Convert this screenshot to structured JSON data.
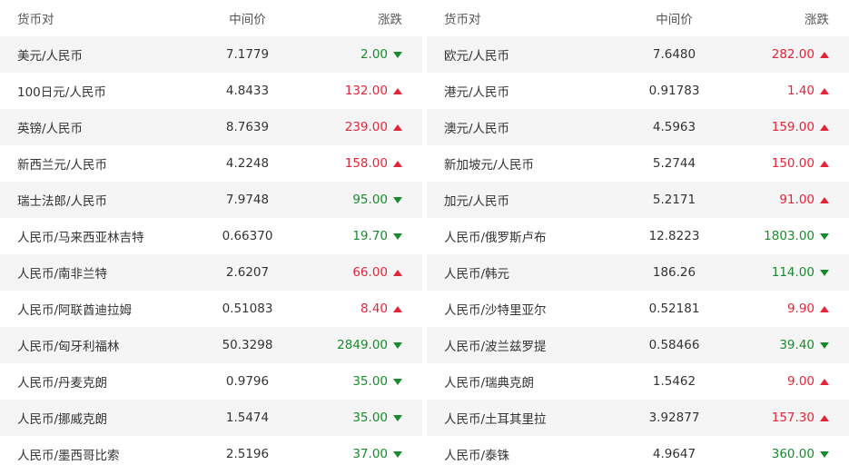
{
  "headers": {
    "pair": "货币对",
    "mid": "中间价",
    "change": "涨跌"
  },
  "colors": {
    "up": "#e5243a",
    "down": "#1a8a2e",
    "stripe": "#f5f5f5"
  },
  "left": [
    {
      "pair": "美元/人民币",
      "mid": "7.1779",
      "change": "2.00",
      "dir": "down"
    },
    {
      "pair": "100日元/人民币",
      "mid": "4.8433",
      "change": "132.00",
      "dir": "up"
    },
    {
      "pair": "英镑/人民币",
      "mid": "8.7639",
      "change": "239.00",
      "dir": "up"
    },
    {
      "pair": "新西兰元/人民币",
      "mid": "4.2248",
      "change": "158.00",
      "dir": "up"
    },
    {
      "pair": "瑞士法郎/人民币",
      "mid": "7.9748",
      "change": "95.00",
      "dir": "down"
    },
    {
      "pair": "人民币/马来西亚林吉特",
      "mid": "0.66370",
      "change": "19.70",
      "dir": "down"
    },
    {
      "pair": "人民币/南非兰特",
      "mid": "2.6207",
      "change": "66.00",
      "dir": "up"
    },
    {
      "pair": "人民币/阿联酋迪拉姆",
      "mid": "0.51083",
      "change": "8.40",
      "dir": "up"
    },
    {
      "pair": "人民币/匈牙利福林",
      "mid": "50.3298",
      "change": "2849.00",
      "dir": "down"
    },
    {
      "pair": "人民币/丹麦克朗",
      "mid": "0.9796",
      "change": "35.00",
      "dir": "down"
    },
    {
      "pair": "人民币/挪威克朗",
      "mid": "1.5474",
      "change": "35.00",
      "dir": "down"
    },
    {
      "pair": "人民币/墨西哥比索",
      "mid": "2.5196",
      "change": "37.00",
      "dir": "down"
    }
  ],
  "right": [
    {
      "pair": "欧元/人民币",
      "mid": "7.6480",
      "change": "282.00",
      "dir": "up"
    },
    {
      "pair": "港元/人民币",
      "mid": "0.91783",
      "change": "1.40",
      "dir": "up"
    },
    {
      "pair": "澳元/人民币",
      "mid": "4.5963",
      "change": "159.00",
      "dir": "up"
    },
    {
      "pair": "新加坡元/人民币",
      "mid": "5.2744",
      "change": "150.00",
      "dir": "up"
    },
    {
      "pair": "加元/人民币",
      "mid": "5.2171",
      "change": "91.00",
      "dir": "up"
    },
    {
      "pair": "人民币/俄罗斯卢布",
      "mid": "12.8223",
      "change": "1803.00",
      "dir": "down"
    },
    {
      "pair": "人民币/韩元",
      "mid": "186.26",
      "change": "114.00",
      "dir": "down"
    },
    {
      "pair": "人民币/沙特里亚尔",
      "mid": "0.52181",
      "change": "9.90",
      "dir": "up"
    },
    {
      "pair": "人民币/波兰兹罗提",
      "mid": "0.58466",
      "change": "39.40",
      "dir": "down"
    },
    {
      "pair": "人民币/瑞典克朗",
      "mid": "1.5462",
      "change": "9.00",
      "dir": "up"
    },
    {
      "pair": "人民币/土耳其里拉",
      "mid": "3.92877",
      "change": "157.30",
      "dir": "up"
    },
    {
      "pair": "人民币/泰铢",
      "mid": "4.9647",
      "change": "360.00",
      "dir": "down"
    }
  ]
}
